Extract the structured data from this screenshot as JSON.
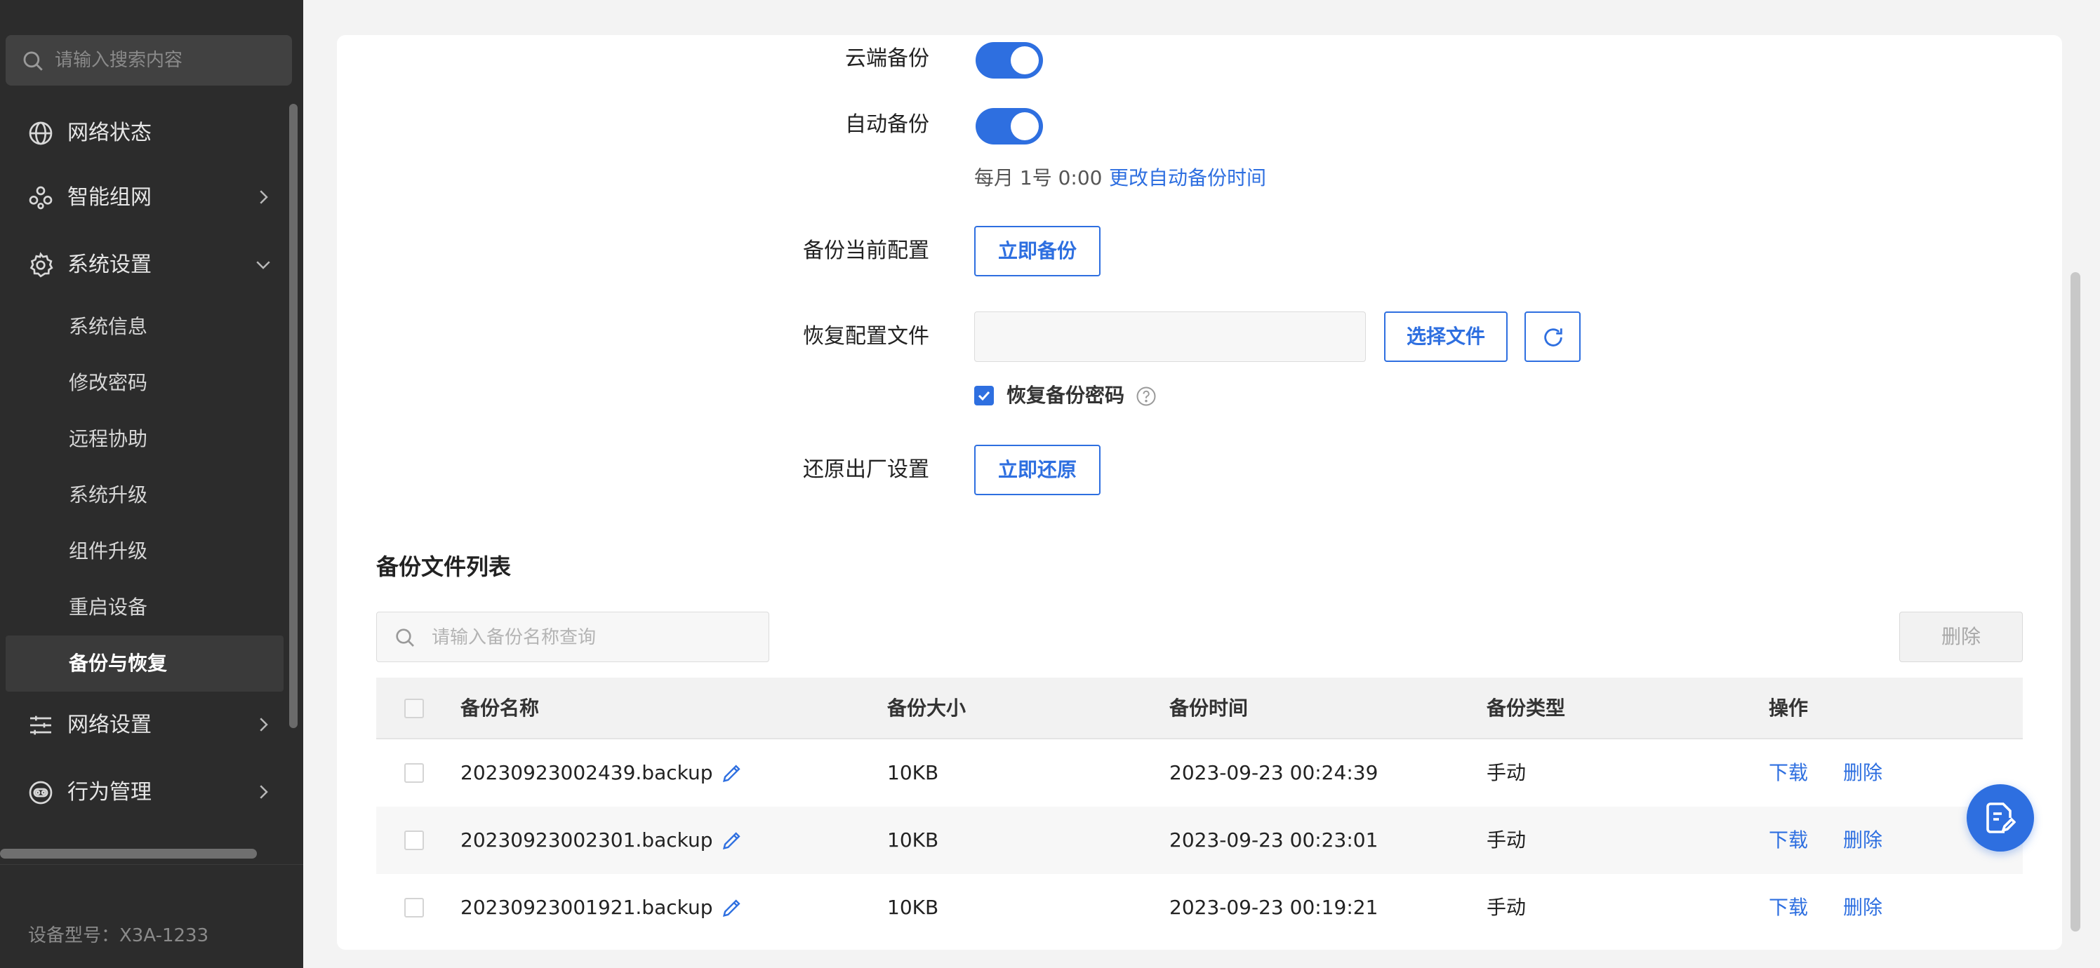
{
  "sidebar": {
    "search_placeholder": "请输入搜索内容",
    "nav": [
      {
        "label": "网络状态",
        "icon": "globe-icon"
      },
      {
        "label": "智能组网",
        "icon": "mesh-network-icon",
        "expandable": true
      },
      {
        "label": "系统设置",
        "icon": "gear-icon",
        "expanded": true
      },
      {
        "label": "网络设置",
        "icon": "sliders-icon",
        "expandable": true
      },
      {
        "label": "行为管理",
        "icon": "behavior-control-icon",
        "expandable": true
      }
    ],
    "sub_items": [
      {
        "label": "系统信息"
      },
      {
        "label": "修改密码"
      },
      {
        "label": "远程协助"
      },
      {
        "label": "系统升级"
      },
      {
        "label": "组件升级"
      },
      {
        "label": "重启设备"
      },
      {
        "label": "备份与恢复",
        "active": true
      }
    ],
    "device_model": "设备型号：X3A-1233"
  },
  "settings": {
    "cloud_backup_label": "云端备份",
    "cloud_backup_on": true,
    "auto_backup_label": "自动备份",
    "auto_backup_on": true,
    "schedule_text": "每月  1号  0:00",
    "schedule_link": "更改自动备份时间",
    "backup_current_label": "备份当前配置",
    "backup_now_button": "立即备份",
    "restore_file_label": "恢复配置文件",
    "choose_file_button": "选择文件",
    "restore_password_label": "恢复备份密码",
    "restore_password_checked": true,
    "factory_reset_label": "还原出厂设置",
    "restore_now_button": "立即还原"
  },
  "backup_list": {
    "title": "备份文件列表",
    "search_placeholder": "请输入备份名称查询",
    "delete_button": "删除",
    "columns": {
      "name": "备份名称",
      "size": "备份大小",
      "time": "备份时间",
      "type": "备份类型",
      "ops": "操作"
    },
    "rows": [
      {
        "name": "20230923002439.backup",
        "size": "10KB",
        "time": "2023-09-23 00:24:39",
        "type": "手动",
        "download": "下载",
        "delete": "删除"
      },
      {
        "name": "20230923002301.backup",
        "size": "10KB",
        "time": "2023-09-23 00:23:01",
        "type": "手动",
        "download": "下载",
        "delete": "删除"
      },
      {
        "name": "20230923001921.backup",
        "size": "10KB",
        "time": "2023-09-23 00:19:21",
        "type": "手动",
        "download": "下载",
        "delete": "删除"
      }
    ]
  },
  "colors": {
    "accent": "#2e6fe0",
    "sidebar_bg": "#2c2c2c",
    "page_bg": "#f3f3f3"
  }
}
